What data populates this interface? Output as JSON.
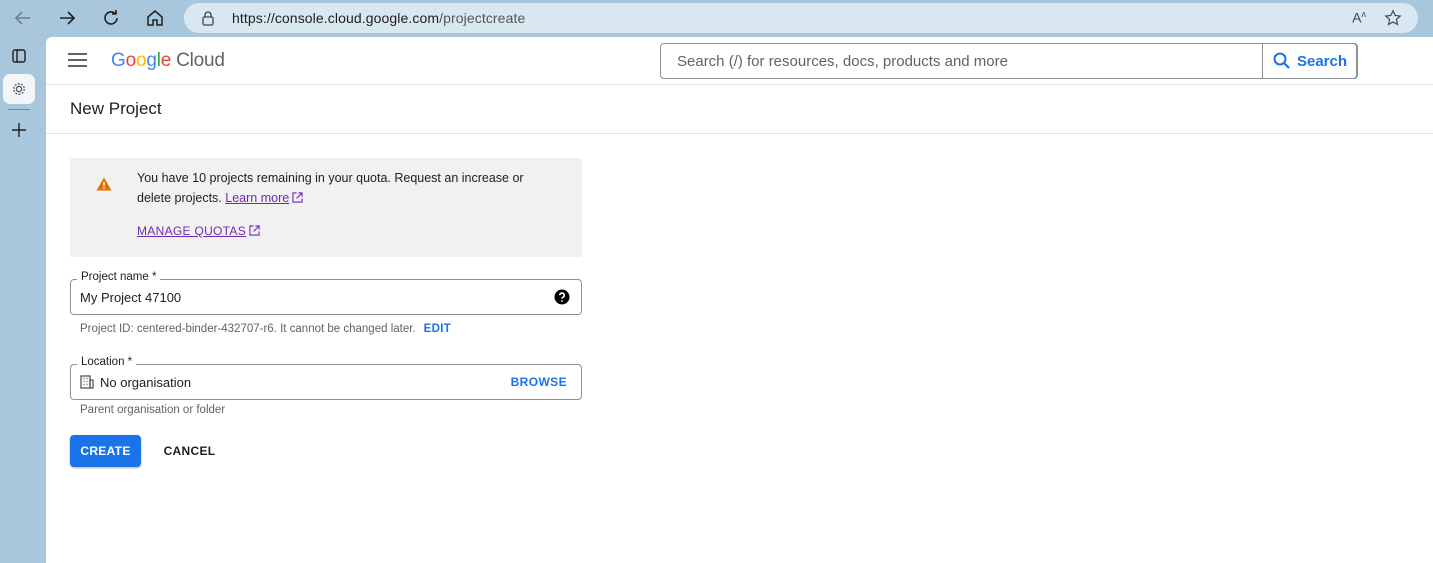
{
  "browser": {
    "url_host": "https://console.cloud.google.com",
    "url_path": "/projectcreate",
    "reader_label": "A̅"
  },
  "header": {
    "logo_letters": [
      "G",
      "o",
      "o",
      "g",
      "l",
      "e"
    ],
    "logo_colors": [
      "#4285F4",
      "#EA4335",
      "#FBBC05",
      "#4285F4",
      "#34A853",
      "#EA4335"
    ],
    "logo_product": "Cloud",
    "search_placeholder": "Search (/) for resources, docs, products and more",
    "search_button": "Search"
  },
  "page": {
    "title": "New Project"
  },
  "quota": {
    "message": "You have 10 projects remaining in your quota. Request an increase or delete projects.",
    "learn_more": "Learn more",
    "manage_quotas": "MANAGE QUOTAS",
    "warning_color": "#E37400"
  },
  "project_name": {
    "label": "Project name *",
    "value": "My Project 47100",
    "hint": "Project ID: centered-binder-432707-r6. It cannot be changed later.",
    "edit": "EDIT"
  },
  "location": {
    "label": "Location *",
    "value": "No organisation",
    "browse": "BROWSE",
    "hint": "Parent organisation or folder"
  },
  "actions": {
    "create": "CREATE",
    "cancel": "CANCEL"
  },
  "colors": {
    "accent": "#1A73E8",
    "link_visited": "#6E2BB0",
    "browser_frame": "#A8C7DC"
  }
}
